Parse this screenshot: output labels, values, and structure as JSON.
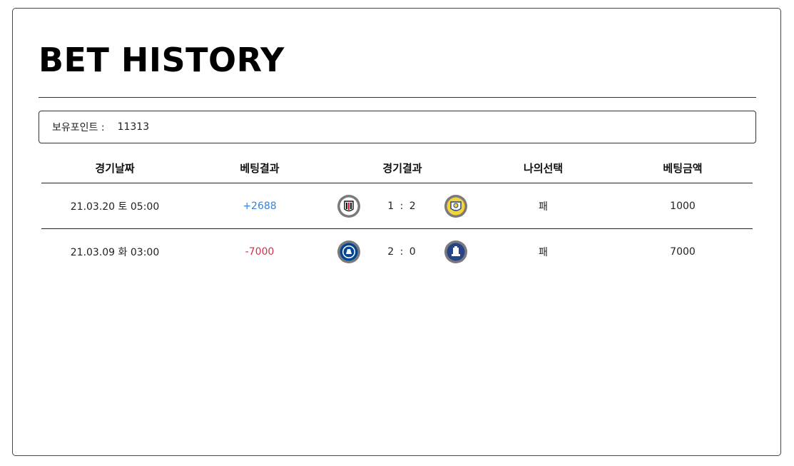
{
  "page": {
    "title": "BET HISTORY"
  },
  "points": {
    "label": "보유포인트 :",
    "value": "11313"
  },
  "table": {
    "headers": [
      "경기날짜",
      "베팅결과",
      "경기결과",
      "나의선택",
      "베팅금액"
    ],
    "rows": [
      {
        "date": "21.03.20 토 05:00",
        "result": "+2688",
        "result_color": "#3b82d6",
        "home_icon": "fulham-crest-icon",
        "score": "1 : 2",
        "away_icon": "leeds-crest-icon",
        "choice": "패",
        "amount": "1000"
      },
      {
        "date": "21.03.09 화 03:00",
        "result": "-7000",
        "result_color": "#d0334a",
        "home_icon": "chelsea-crest-icon",
        "score": "2 : 0",
        "away_icon": "everton-crest-icon",
        "choice": "패",
        "amount": "7000"
      }
    ]
  }
}
